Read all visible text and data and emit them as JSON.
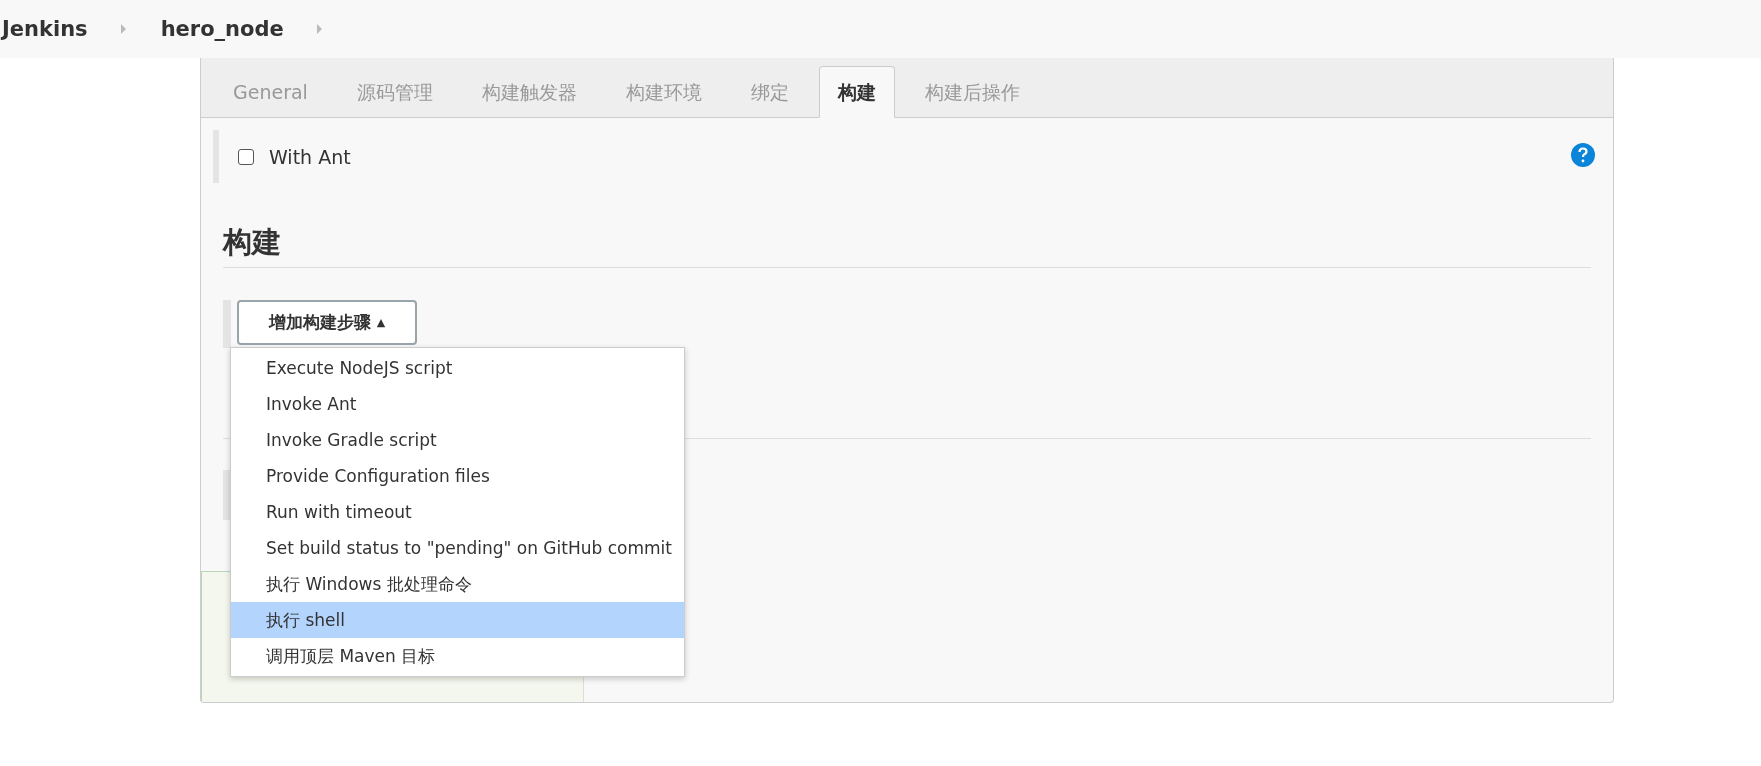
{
  "breadcrumbs": [
    {
      "label": "Jenkins"
    },
    {
      "label": "hero_node"
    }
  ],
  "tabs": [
    {
      "label": "General",
      "selected": false
    },
    {
      "label": "源码管理",
      "selected": false
    },
    {
      "label": "构建触发器",
      "selected": false
    },
    {
      "label": "构建环境",
      "selected": false
    },
    {
      "label": "绑定",
      "selected": false
    },
    {
      "label": "构建",
      "selected": true
    },
    {
      "label": "构建后操作",
      "selected": false
    }
  ],
  "option": {
    "label": "With Ant",
    "checked": false
  },
  "section": {
    "title": "构建",
    "button": "增加构建步骤",
    "caret": "▲"
  },
  "menu": [
    {
      "label": "Execute NodeJS script",
      "selected": false
    },
    {
      "label": "Invoke Ant",
      "selected": false
    },
    {
      "label": "Invoke Gradle script",
      "selected": false
    },
    {
      "label": "Provide Configuration files",
      "selected": false
    },
    {
      "label": "Run with timeout",
      "selected": false
    },
    {
      "label": "Set build status to \"pending\" on GitHub commit",
      "selected": false
    },
    {
      "label": "执行 Windows 批处理命令",
      "selected": false
    },
    {
      "label": "执行 shell",
      "selected": true
    },
    {
      "label": "调用顶层 Maven 目标",
      "selected": false
    }
  ]
}
